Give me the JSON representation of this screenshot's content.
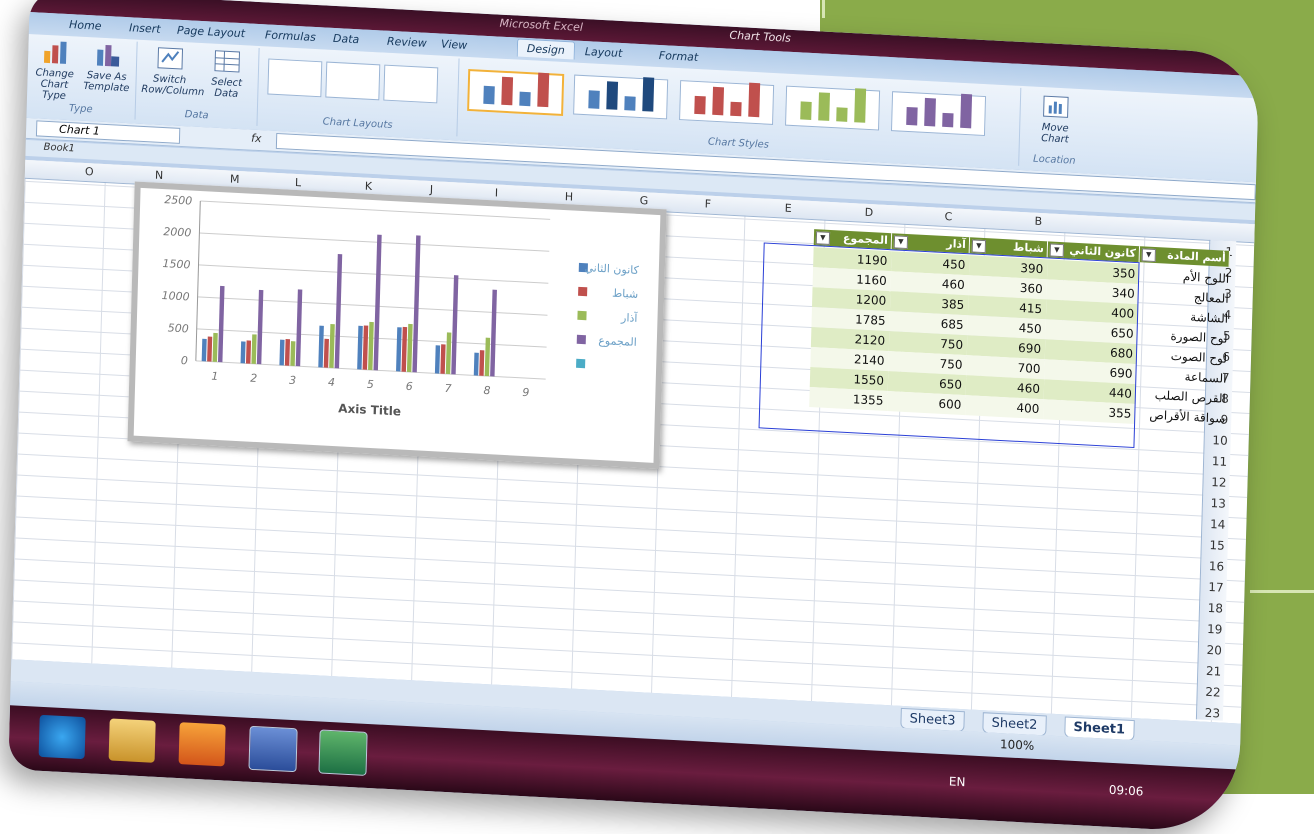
{
  "window": {
    "app_title": "Microsoft Excel",
    "context_title": "Chart Tools",
    "workbook_title": "Book1"
  },
  "ribbon_tabs": [
    "Home",
    "Insert",
    "Page Layout",
    "Formulas",
    "Data",
    "Review",
    "View",
    "Design",
    "Layout",
    "Format"
  ],
  "active_tab": "Design",
  "ribbon": {
    "type_group": {
      "label": "Type",
      "change_chart_type": "Change Chart Type",
      "save_as_template": "Save As Template"
    },
    "data_group": {
      "label": "Data",
      "switch_row_column": "Switch Row/Column",
      "select_data": "Select Data"
    },
    "layouts_group": {
      "label": "Chart Layouts"
    },
    "styles_group": {
      "label": "Chart Styles"
    },
    "location_group": {
      "label": "Location",
      "move_chart": "Move Chart"
    }
  },
  "formula_bar": {
    "name_box": "Chart 1",
    "fx": "fx",
    "formula": ""
  },
  "columns": [
    "O",
    "N",
    "M",
    "L",
    "K",
    "J",
    "I",
    "H",
    "G",
    "F",
    "E",
    "D",
    "C",
    "B"
  ],
  "rows": [
    "1",
    "2",
    "3",
    "4",
    "5",
    "6",
    "7",
    "8",
    "9",
    "10",
    "11",
    "12",
    "13",
    "14",
    "15",
    "16",
    "17",
    "18",
    "19",
    "20",
    "21",
    "22",
    "23"
  ],
  "table": {
    "headers": [
      "أسم المادة",
      "كانون الثاني",
      "شباط",
      "آذار",
      "المجموع"
    ],
    "rows": [
      {
        "name": "اللوح الأم",
        "c": "350",
        "d": "390",
        "e": "450",
        "f": "1190"
      },
      {
        "name": "المعالج",
        "c": "340",
        "d": "360",
        "e": "460",
        "f": "1160"
      },
      {
        "name": "الشاشة",
        "c": "400",
        "d": "415",
        "e": "385",
        "f": "1200"
      },
      {
        "name": "لوح الصورة",
        "c": "650",
        "d": "450",
        "e": "685",
        "f": "1785"
      },
      {
        "name": "لوح الصوت",
        "c": "680",
        "d": "690",
        "e": "750",
        "f": "2120"
      },
      {
        "name": "السماعة",
        "c": "690",
        "d": "700",
        "e": "750",
        "f": "2140"
      },
      {
        "name": "القرص الصلب",
        "c": "440",
        "d": "460",
        "e": "650",
        "f": "1550"
      },
      {
        "name": "سواقة الأقراص",
        "c": "355",
        "d": "400",
        "e": "600",
        "f": "1355"
      }
    ]
  },
  "chart_data": {
    "type": "bar",
    "categories": [
      "1",
      "2",
      "3",
      "4",
      "5",
      "6",
      "7",
      "8",
      "9"
    ],
    "series": [
      {
        "name": "كانون الثاني",
        "color": "#4f81bd",
        "values": [
          350,
          340,
          400,
          650,
          680,
          690,
          440,
          355,
          0
        ]
      },
      {
        "name": "شباط",
        "color": "#c0504d",
        "values": [
          390,
          360,
          415,
          450,
          690,
          700,
          460,
          400,
          0
        ]
      },
      {
        "name": "آذار",
        "color": "#9bbb59",
        "values": [
          450,
          460,
          385,
          685,
          750,
          750,
          650,
          600,
          0
        ]
      },
      {
        "name": "المجموع",
        "color": "#8064a2",
        "values": [
          1190,
          1160,
          1200,
          1785,
          2120,
          2140,
          1550,
          1355,
          0
        ]
      },
      {
        "name": "",
        "color": "#4bacc6",
        "values": [
          0,
          0,
          0,
          0,
          0,
          0,
          0,
          0,
          0
        ]
      }
    ],
    "y_ticks": [
      "0",
      "500",
      "1000",
      "1500",
      "2000",
      "2500"
    ],
    "ylim": [
      0,
      2500
    ],
    "xlabel": "Axis Title",
    "legend_position": "right",
    "grid": true
  },
  "sheet_tabs": [
    "Sheet3",
    "Sheet2",
    "Sheet1"
  ],
  "active_sheet": "Sheet1",
  "status": {
    "zoom": "100%"
  },
  "tray": {
    "lang": "EN",
    "time": "09:06"
  },
  "icon_colors": {
    "accent": "#6e8f2f",
    "excel": "#1d7044"
  }
}
